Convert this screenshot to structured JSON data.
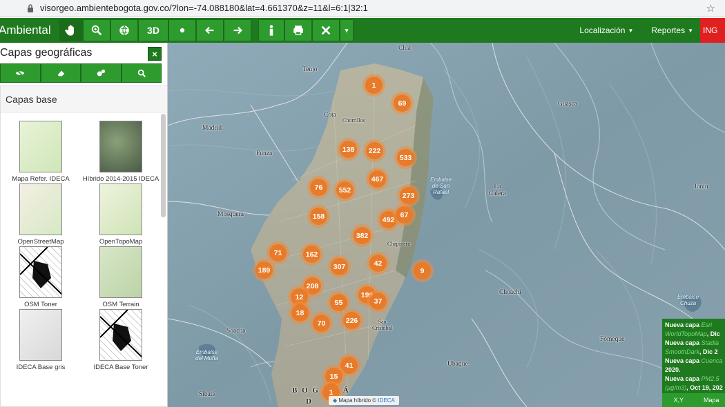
{
  "browser": {
    "url": "visorgeo.ambientebogota.gov.co/?lon=-74.088180&lat=4.661370&z=11&l=6:1|32:1"
  },
  "toolbar": {
    "brand": "Ambiental",
    "btn_3d": "3D",
    "localizacion": "Localización",
    "reportes": "Reportes",
    "ing": "ING"
  },
  "panel": {
    "title": "Capas geográficas",
    "close": "×",
    "section": "Capas base",
    "layers": [
      {
        "label": "Mapa Refer. IDECA",
        "style": "refer"
      },
      {
        "label": "Híbrido 2014-2015 IDECA",
        "style": "hybrid"
      },
      {
        "label": "OpenStreetMap",
        "style": "osm"
      },
      {
        "label": "OpenTopoMap",
        "style": "topo"
      },
      {
        "label": "OSM Toner",
        "style": "toner"
      },
      {
        "label": "OSM Terrain",
        "style": "terrain"
      },
      {
        "label": "IDECA Base gris",
        "style": "gris"
      },
      {
        "label": "IDECA Base Toner",
        "style": "toner"
      }
    ]
  },
  "map": {
    "places": {
      "chia": "Chía",
      "tenjo": "Tenjo",
      "cota": "Cota",
      "chorrillos": "Chorrillos",
      "madrid": "Madrid",
      "funza": "Funza",
      "mosquera": "Mosquera",
      "guasca": "Guasca",
      "la_calera": "La\nCalera",
      "junin": "Junín",
      "choachi": "Choachí",
      "soacha": "Soacha",
      "fomeque": "Fómeque",
      "ubaque": "Ubaque",
      "sibate": "Sibaté",
      "chapinero": "Chapinero",
      "san_cristobal": "San\nCristóbal",
      "bogota": "B O G O T Á",
      "bogota2": "D"
    },
    "water": {
      "san_rafael": "Embalse\nde San\nRafael",
      "chuza": "Embalse\nChuza",
      "muna": "Embalse\ndel Muña"
    },
    "clusters": [
      "1",
      "69",
      "138",
      "222",
      "533",
      "467",
      "76",
      "552",
      "273",
      "158",
      "492",
      "67",
      "382",
      "71",
      "162",
      "307",
      "42",
      "189",
      "9",
      "208",
      "199",
      "12",
      "55",
      "37",
      "18",
      "70",
      "226",
      "41",
      "15",
      "1"
    ],
    "attribution": "Mapa híbrido ©",
    "attribution_link": "IDECA"
  },
  "news": {
    "items": [
      {
        "prefix": "Nueva capa ",
        "name": "Esri WorldTopoMap",
        "suffix": ", Dic"
      },
      {
        "prefix": "Nueva capa ",
        "name": "Stadia SmoothDark",
        "suffix": ", Dic 2"
      },
      {
        "prefix": "Nueva capa ",
        "name": "Cuenca",
        "suffix": " 2020."
      },
      {
        "prefix": "Nueva capa ",
        "name": "PM2.5 (µg/m3)",
        "suffix": ", Oct 19, 202"
      }
    ],
    "foot_xy": "X,Y",
    "foot_mapa": "Mapa"
  }
}
